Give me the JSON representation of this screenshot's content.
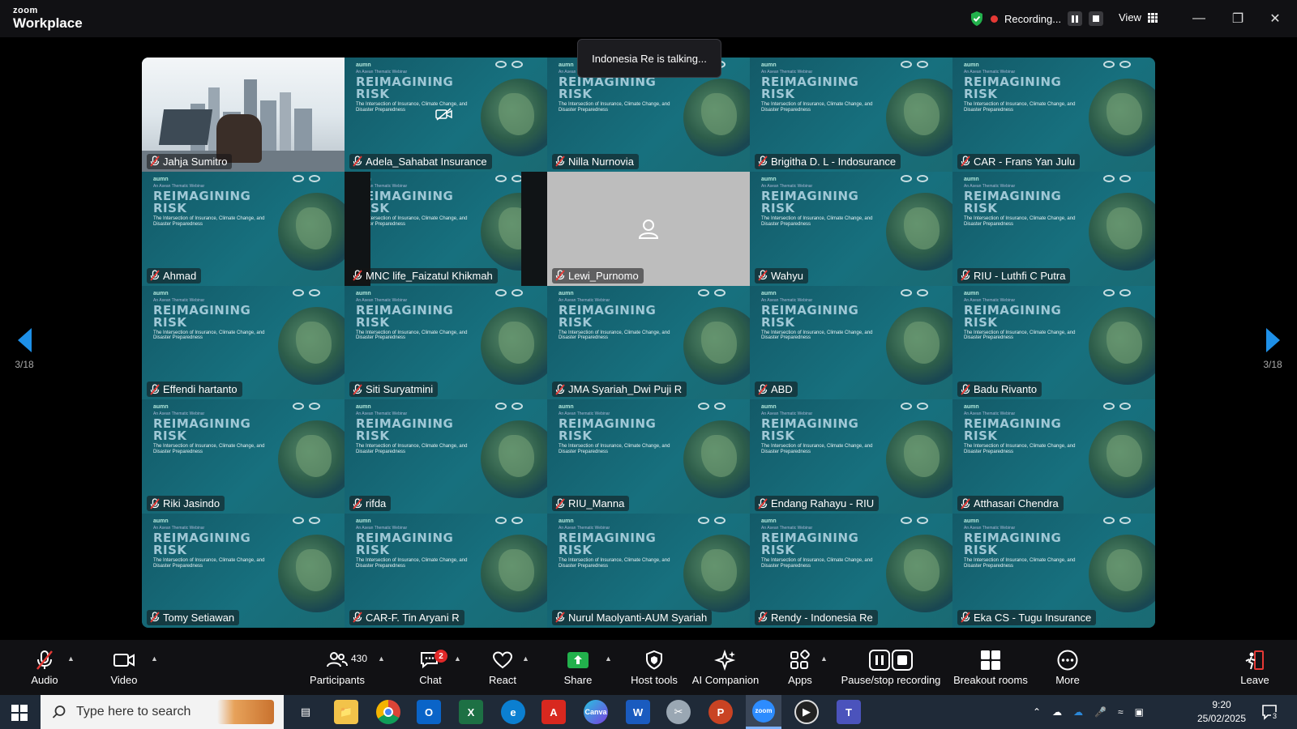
{
  "app": {
    "brand_small": "zoom",
    "brand_large": "Workplace"
  },
  "titlebar": {
    "recording_label": "Recording...",
    "view_label": "View",
    "colors": {
      "shield": "#22b14c",
      "rec_dot": "#e53935"
    }
  },
  "toast": {
    "text": "Indonesia Re is talking..."
  },
  "slide": {
    "line1": "An Asean Thematic Webinar",
    "title": "REIMAGINING RISK",
    "line3": "The Intersection of Insurance, Climate Change, and Disaster Preparedness",
    "brand": "aumn"
  },
  "participants": [
    {
      "name": "Jahja Sumitro"
    },
    {
      "name": "Adela_Sahabat Insurance"
    },
    {
      "name": "Nilla Nurnovia"
    },
    {
      "name": "Brigitha D. L - Indosurance"
    },
    {
      "name": "CAR - Frans Yan Julu"
    },
    {
      "name": "Ahmad"
    },
    {
      "name": "MNC life_Faizatul Khikmah"
    },
    {
      "name": "Lewi_Purnomo"
    },
    {
      "name": "Wahyu"
    },
    {
      "name": "RIU - Luthfi C Putra"
    },
    {
      "name": "Effendi hartanto"
    },
    {
      "name": "Siti Suryatmini"
    },
    {
      "name": "JMA Syariah_Dwi Puji R"
    },
    {
      "name": "ABD"
    },
    {
      "name": "Badu Rivanto"
    },
    {
      "name": "Riki Jasindo"
    },
    {
      "name": "rifda"
    },
    {
      "name": "RIU_Manna"
    },
    {
      "name": "Endang Rahayu - RIU"
    },
    {
      "name": "Atthasari Chendra"
    },
    {
      "name": "Tomy Setiawan"
    },
    {
      "name": "CAR-F. Tin Aryani R"
    },
    {
      "name": "Nurul Maolyanti-AUM Syariah"
    },
    {
      "name": "Rendy - Indonesia Re"
    },
    {
      "name": "Eka CS - Tugu Insurance"
    }
  ],
  "pagination": {
    "left": "3/18",
    "right": "3/18",
    "arrow_color": "#1e90e8"
  },
  "toolbar": {
    "audio": "Audio",
    "video": "Video",
    "participants": "Participants",
    "participants_count": "430",
    "chat": "Chat",
    "chat_badge": "2",
    "react": "React",
    "share": "Share",
    "host_tools": "Host tools",
    "ai_companion": "AI Companion",
    "apps": "Apps",
    "pause_stop": "Pause/stop recording",
    "breakout": "Breakout rooms",
    "more": "More",
    "leave": "Leave",
    "colors": {
      "share": "#22b14c",
      "leave": "#e53935"
    }
  },
  "taskbar": {
    "search_placeholder": "Type here to search",
    "time": "9:20",
    "date": "25/02/2025",
    "notification_count": "3"
  }
}
